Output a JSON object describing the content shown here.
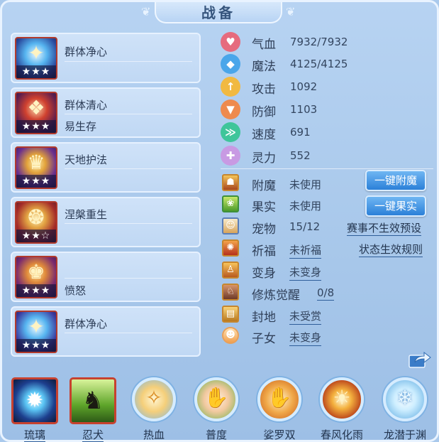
{
  "title": "战备",
  "skills": [
    {
      "name": "群体净心",
      "sub": "",
      "stars": "★★★",
      "glyph": "✦"
    },
    {
      "name": "群体清心",
      "sub": "易生存",
      "stars": "★★★",
      "glyph": "❖"
    },
    {
      "name": "天地护法",
      "sub": "",
      "stars": "★★★",
      "glyph": "♛"
    },
    {
      "name": "涅槃重生",
      "sub": "",
      "stars": "★★☆",
      "glyph": "❂"
    },
    {
      "name": "",
      "sub": "愤怒",
      "stars": "★★★",
      "glyph": "♚"
    },
    {
      "name": "群体净心",
      "sub": "",
      "stars": "★★★",
      "glyph": "✦"
    }
  ],
  "attributes": [
    {
      "label": "气血",
      "value": "7932/7932",
      "icon": "heart-icon",
      "color": "#e66b7e",
      "glyph": "♥"
    },
    {
      "label": "魔法",
      "value": "4125/4125",
      "icon": "drop-icon",
      "color": "#4aa6ea",
      "glyph": "◆"
    },
    {
      "label": "攻击",
      "value": "1092",
      "icon": "sword-icon",
      "color": "#f1b941",
      "glyph": "↑"
    },
    {
      "label": "防御",
      "value": "1103",
      "icon": "shield-icon",
      "color": "#ee8a4e",
      "glyph": "▼"
    },
    {
      "label": "速度",
      "value": "691",
      "icon": "speed-icon",
      "color": "#3fc59a",
      "glyph": "≫"
    },
    {
      "label": "灵力",
      "value": "552",
      "icon": "spirit-icon",
      "color": "#c89ae3",
      "glyph": "✚"
    }
  ],
  "statuses": [
    {
      "label": "附魔",
      "value": "未使用",
      "underline": false,
      "glyph": "☗"
    },
    {
      "label": "果实",
      "value": "未使用",
      "underline": false,
      "glyph": "❀"
    },
    {
      "label": "宠物",
      "value": "15/12",
      "underline": false,
      "glyph": "☺"
    },
    {
      "label": "祈福",
      "value": "未祈福",
      "underline": true,
      "glyph": "✺"
    },
    {
      "label": "变身",
      "value": "未变身",
      "underline": true,
      "glyph": "♙"
    },
    {
      "label": "修炼觉醒",
      "value": "0/8",
      "underline": true,
      "glyph": "♘"
    },
    {
      "label": "封地",
      "value": "未受赏",
      "underline": true,
      "glyph": "▤"
    },
    {
      "label": "子女",
      "value": "未变身",
      "underline": true,
      "glyph": "☻"
    }
  ],
  "buttons": {
    "enchant": "一键附魔",
    "fruit": "一键果实"
  },
  "links": {
    "event_preset": "赛事不生效预设",
    "status_rules": "状态生效规则"
  },
  "bottom_skills": [
    {
      "label": "琉璃",
      "type": "square",
      "glyph": "✹"
    },
    {
      "label": "忍犬",
      "type": "square",
      "glyph": "♞"
    },
    {
      "label": "热血",
      "type": "circle",
      "glyph": "✧"
    },
    {
      "label": "普度",
      "type": "circle",
      "glyph": "✋"
    },
    {
      "label": "娑罗双",
      "type": "circle",
      "glyph": "✋"
    },
    {
      "label": "春风化雨",
      "type": "circle",
      "glyph": "☀"
    },
    {
      "label": "龙潜于渊",
      "type": "circle",
      "glyph": "❄"
    }
  ]
}
